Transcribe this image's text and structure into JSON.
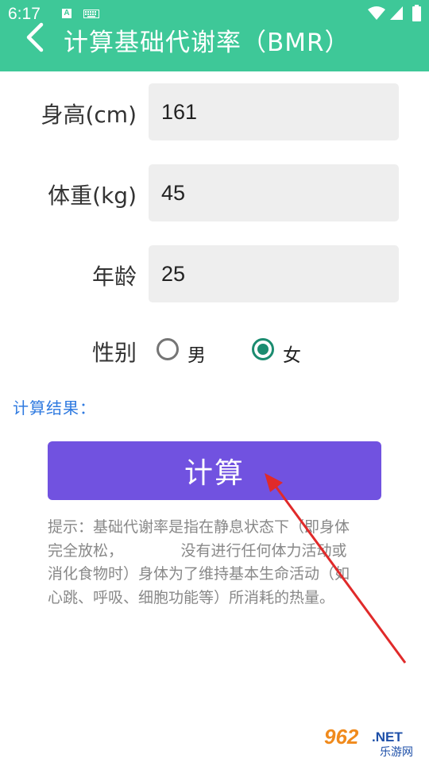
{
  "status_bar": {
    "time": "6:17",
    "notification_icon_letter": "A",
    "icons": [
      "keyboard-icon",
      "wifi-icon",
      "signal-icon",
      "battery-icon"
    ]
  },
  "header": {
    "title": "计算基础代谢率（BMR）",
    "back_icon": "chevron-left-icon",
    "background_color": "#3ec898"
  },
  "form": {
    "height": {
      "label": "身高(cm)",
      "value": "161"
    },
    "weight": {
      "label": "体重(kg)",
      "value": "45"
    },
    "age": {
      "label": "年龄",
      "value": "25"
    },
    "gender": {
      "label": "性别",
      "options": [
        {
          "label": "男",
          "selected": false
        },
        {
          "label": "女",
          "selected": true
        }
      ],
      "selected_color": "#1b8c70"
    }
  },
  "result": {
    "label": "计算结果：",
    "color": "#2f7ae0"
  },
  "calculate_button": {
    "label": "计算",
    "color": "#7152e0"
  },
  "hint": {
    "lines": [
      "提示：基础代谢率是指在静息状态下（即身体",
      "完全放松，            没有进行任何体力活动或",
      "消化食物时）身体为了维持基本生命活动（如",
      "心跳、呼吸、细胞功能等）所消耗的热量。"
    ]
  },
  "watermark": {
    "number": "962",
    "suffix": ".NET",
    "caption": "乐游网"
  }
}
